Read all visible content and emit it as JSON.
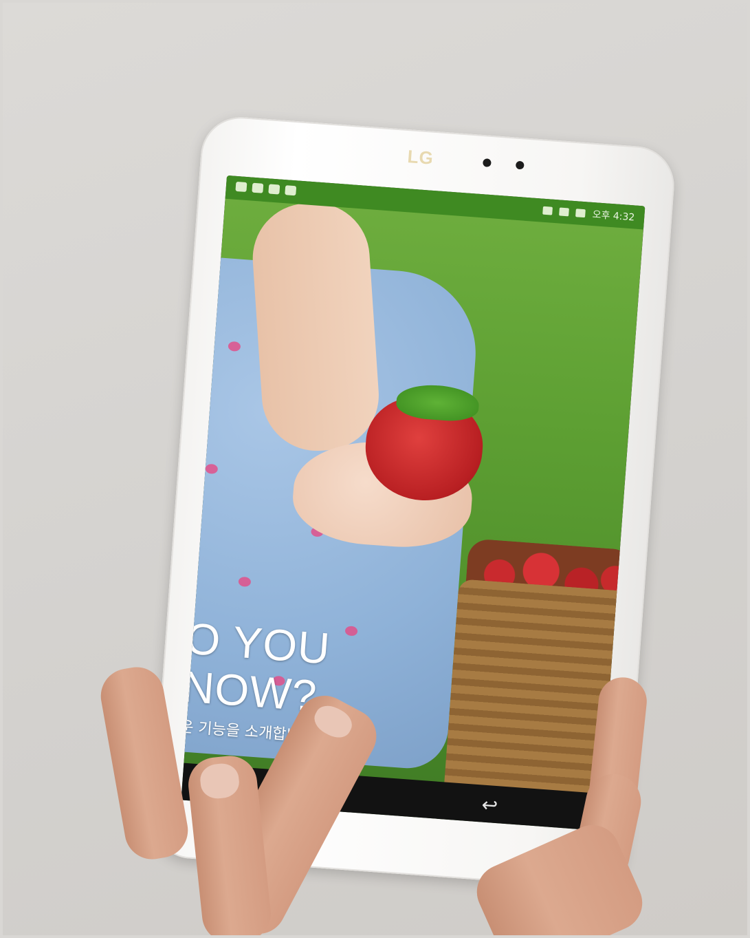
{
  "tablet": {
    "brand_logo": "LG",
    "status_bar": {
      "time": "오후 4:32"
    },
    "screen": {
      "headline_line1": "O YOU",
      "headline_line2": "NOW?",
      "subtitle": "운 기능을 소개합니다"
    },
    "nav_bar": {
      "menu_icon": "menu-icon",
      "back_icon": "back-icon"
    }
  }
}
